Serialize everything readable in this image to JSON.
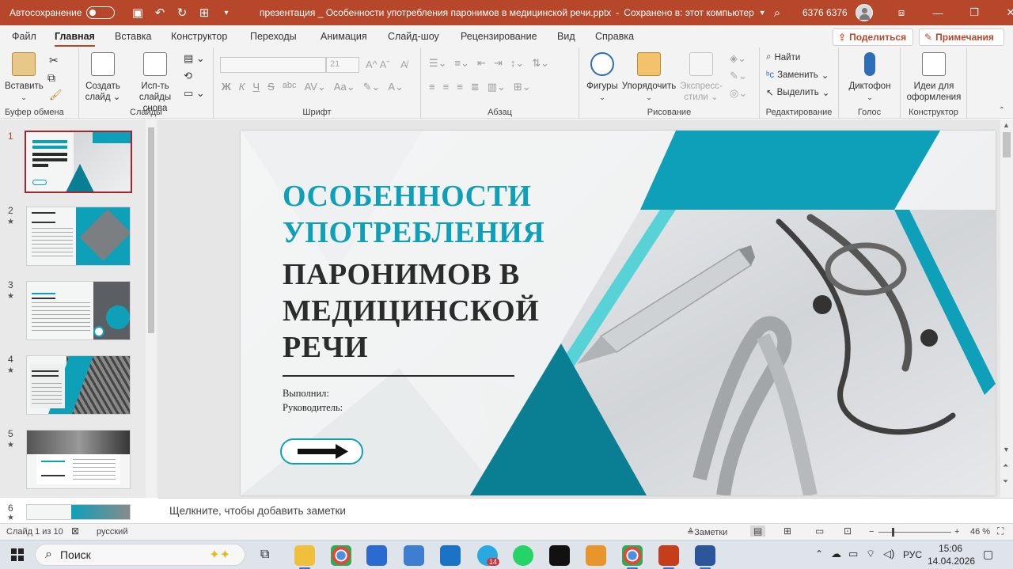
{
  "titlebar": {
    "autosave_label": "Автосохранение",
    "doc_title": "презентация _ Особенности употребления паронимов в медицинской речи.pptx",
    "save_status": "Сохранено в: этот компьютер",
    "user_name": "6376 6376"
  },
  "menu": {
    "tabs": [
      "Файл",
      "Главная",
      "Вставка",
      "Конструктор",
      "Переходы",
      "Анимация",
      "Слайд-шоу",
      "Рецензирование",
      "Вид",
      "Справка"
    ],
    "active_tab": "Главная",
    "share_label": "Поделиться",
    "comments_label": "Примечания"
  },
  "ribbon": {
    "clipboard": {
      "paste": "Вставить",
      "group": "Буфер обмена"
    },
    "slides": {
      "new_slide": [
        "Создать",
        "слайд"
      ],
      "reuse": [
        "Исп-ть",
        "слайды снова"
      ],
      "group": "Слайды"
    },
    "font": {
      "size": "21",
      "group": "Шрифт",
      "bold": "Ж",
      "italic": "К",
      "underline": "Ч",
      "strike": "S",
      "shadow": "abc"
    },
    "paragraph": {
      "group": "Абзац"
    },
    "drawing": {
      "shapes": "Фигуры",
      "arrange": "Упорядочить",
      "styles": [
        "Экспресс-",
        "стили"
      ],
      "group": "Рисование"
    },
    "editing": {
      "find": "Найти",
      "replace": "Заменить",
      "select": "Выделить",
      "group": "Редактирование"
    },
    "voice": {
      "dictate": "Диктофон",
      "group": "Голос"
    },
    "designer": {
      "ideas": [
        "Идеи для",
        "оформления"
      ],
      "group": "Конструктор"
    }
  },
  "slides_panel": {
    "numbers": [
      "1",
      "2",
      "3",
      "4",
      "5",
      "6"
    ],
    "active": 1,
    "animated_star": "★"
  },
  "slide": {
    "title_cyan": [
      "ОСОБЕННОСТИ",
      "УПОТРЕБЛЕНИЯ"
    ],
    "title_dark": [
      "ПАРОНИМОВ В",
      "МЕДИЦИНСКОЙ",
      "РЕЧИ"
    ],
    "performer": "Выполнил:",
    "supervisor": "Руководитель:",
    "colors": {
      "accent": "#0fa0b9",
      "accent_dark": "#0a7f93",
      "accent_light": "#57d3d8",
      "title_dark": "#2b2b2b"
    }
  },
  "notes": {
    "placeholder": "Щелкните, чтобы добавить заметки"
  },
  "status": {
    "slide_info": "Слайд 1 из 10",
    "language": "русский",
    "notes_btn": "Заметки",
    "zoom": "46 %"
  },
  "taskbar": {
    "search": "Поиск",
    "lang": "РУС",
    "time": "15:06",
    "date": "14.04.2026",
    "telegram_badge": "14"
  }
}
